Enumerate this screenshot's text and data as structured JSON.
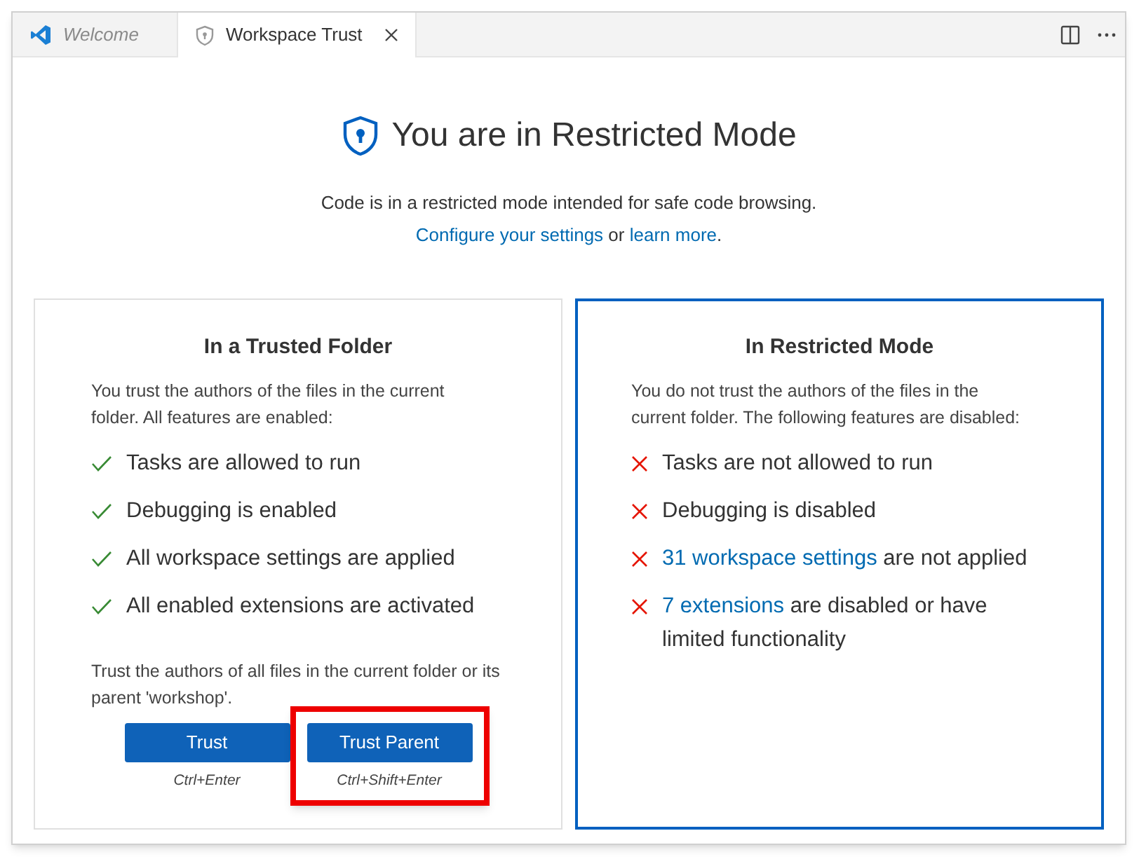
{
  "tabs": [
    {
      "label": "Welcome",
      "kind": "welcome",
      "selected": false
    },
    {
      "label": "Workspace Trust",
      "kind": "trust",
      "selected": true
    }
  ],
  "heading": "You are in Restricted Mode",
  "description": "Code is in a restricted mode intended for safe code browsing.",
  "description_links": [
    {
      "text": "Configure your settings",
      "link": true
    },
    {
      "text": " or ",
      "link": false
    },
    {
      "text": "learn more",
      "link": true
    },
    {
      "text": ".",
      "link": false
    }
  ],
  "cards": [
    {
      "kind": "trusted",
      "selected": false,
      "title": "In a Trusted Folder",
      "intro": "You trust the authors of the files in the current folder. All features are enabled:",
      "items": [
        [
          {
            "text": "Tasks are allowed to run",
            "link": false
          }
        ],
        [
          {
            "text": "Debugging is enabled",
            "link": false
          }
        ],
        [
          {
            "text": "All workspace settings are applied",
            "link": false
          }
        ],
        [
          {
            "text": "All enabled extensions are activated",
            "link": false
          }
        ]
      ],
      "footer": "Trust the authors of all files in the current folder or its parent 'workshop'.",
      "buttons": [
        {
          "label": "Trust",
          "shortcut": "Ctrl+Enter",
          "highlighted": false
        },
        {
          "label": "Trust Parent",
          "shortcut": "Ctrl+Shift+Enter",
          "highlighted": true
        }
      ]
    },
    {
      "kind": "restricted",
      "selected": true,
      "title": "In Restricted Mode",
      "intro": "You do not trust the authors of the files in the current folder. The following features are disabled:",
      "items": [
        [
          {
            "text": "Tasks are not allowed to run",
            "link": false
          }
        ],
        [
          {
            "text": "Debugging is disabled",
            "link": false
          }
        ],
        [
          {
            "text": "31 workspace settings",
            "link": true
          },
          {
            "text": " are not applied",
            "link": false
          }
        ],
        [
          {
            "text": "7 extensions",
            "link": true
          },
          {
            "text": " are disabled or have limited functionality",
            "link": false
          }
        ]
      ]
    }
  ]
}
